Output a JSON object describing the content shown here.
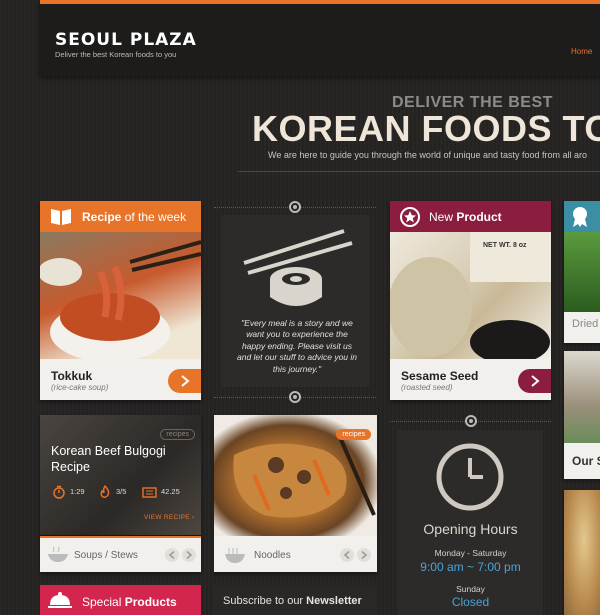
{
  "header": {
    "logo_name": "SEOUL PLAZA",
    "logo_tagline": "Deliver the best Korean foods to you",
    "nav_home": "Home"
  },
  "hero": {
    "kicker": "DELIVER THE BEST",
    "headline": "KOREAN FOODS TO",
    "subtitle": "We are here to guide you through the world of unique and tasty food from all aro"
  },
  "recipe_week": {
    "title_strong": "Recipe",
    "title_rest": " of the week",
    "dish_name": "Tokkuk",
    "dish_desc": "(rice-cake soup)"
  },
  "quote": {
    "text": "\"Every meal is a story and we want you to experience the happy ending. Please visit us and let our stuff to advice you in this journey.\""
  },
  "new_product": {
    "title_rest": "New ",
    "title_strong": "Product",
    "product_name": "Sesame Seed",
    "product_desc": "(roasted seed)",
    "label_text": "NET WT. 8 oz"
  },
  "side_cards": {
    "teal_label": "Dried",
    "store_label": "Our S"
  },
  "bulgogi": {
    "tag": "recipes",
    "title": "Korean Beef Bulgogi Recipe",
    "time": "1:29",
    "difficulty": "3/5",
    "cost": "42.25",
    "view_link": "VIEW RECIPE",
    "category": "Soups / Stews"
  },
  "noodles": {
    "tag": "recipes",
    "category": "Noodles"
  },
  "hours": {
    "title": "Opening Hours",
    "weekdays": "Monday - Saturday",
    "weekday_time": "9:00 am ~ 7:00 pm",
    "sunday": "Sunday",
    "sunday_status": "Closed"
  },
  "special": {
    "title_rest": "Special ",
    "title_strong": "Products"
  },
  "newsletter": {
    "title_rest": "Subscribe to our ",
    "title_strong": "Newsletter"
  },
  "colors": {
    "accent_orange": "#e8742a",
    "product_maroon": "#8b1e3f",
    "special_red": "#d2264f",
    "info_blue": "#4aa3d8",
    "teal": "#3b8fa5"
  }
}
